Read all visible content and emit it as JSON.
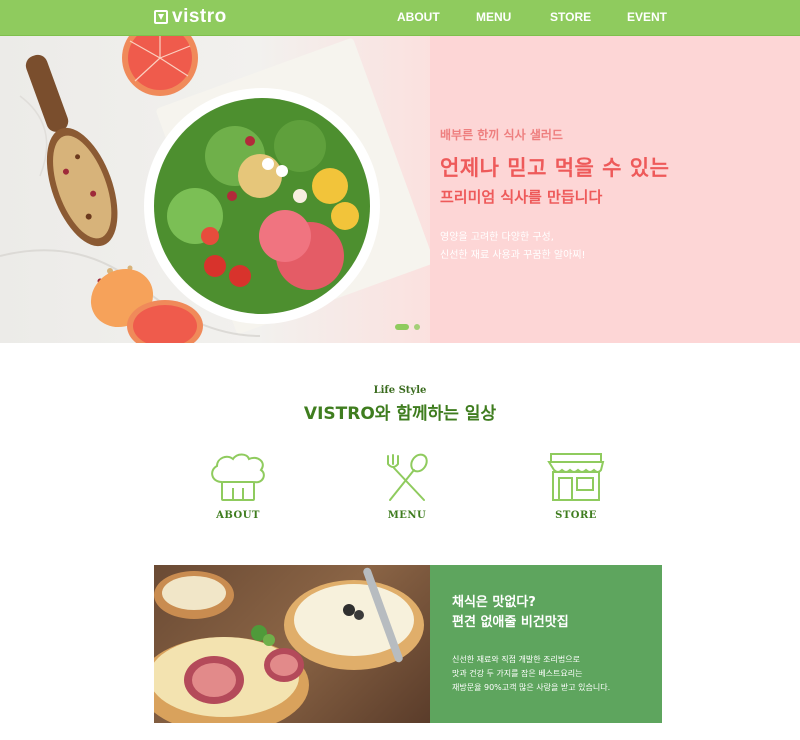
{
  "header": {
    "logo_text": "vistro",
    "nav": [
      "ABOUT",
      "MENU",
      "STORE",
      "EVENT"
    ]
  },
  "hero": {
    "kicker": "배부른 한끼 식사 샐러드",
    "title": "언제나 믿고 먹을 수 있는",
    "subtitle": "프리미엄 식사를 만듭니다",
    "desc_line1": "영양을 고려한 다양한 구성,",
    "desc_line2": "신선한 재료 사용과 꾸꿈한 알아찌!",
    "slides_total": 2,
    "slide_active": 1
  },
  "lifestyle": {
    "kicker": "Life Style",
    "title": "VISTRO와 함께하는 일상",
    "features": [
      {
        "label": "ABOUT",
        "icon": "chef-hat-icon"
      },
      {
        "label": "MENU",
        "icon": "fork-spoon-icon"
      },
      {
        "label": "STORE",
        "icon": "storefront-icon"
      }
    ]
  },
  "promo": {
    "title_line1": "채식은 맛없다?",
    "title_line2": "편견 없애줄 비건맛집",
    "desc_line1": "신선한 재료와 직접 개발한 조리법으로",
    "desc_line2": "맛과 건강 두 가지를 잡은 베스트요리는",
    "desc_line3": "재방문율 90%고객 많은 사랑을 받고 있습니다."
  },
  "colors": {
    "brand_green": "#8fcb5e",
    "dark_green": "#3f7d1f",
    "promo_green": "#5ea55e",
    "hero_pink": "#fdd6d6",
    "hero_red": "#ee5a5a"
  }
}
